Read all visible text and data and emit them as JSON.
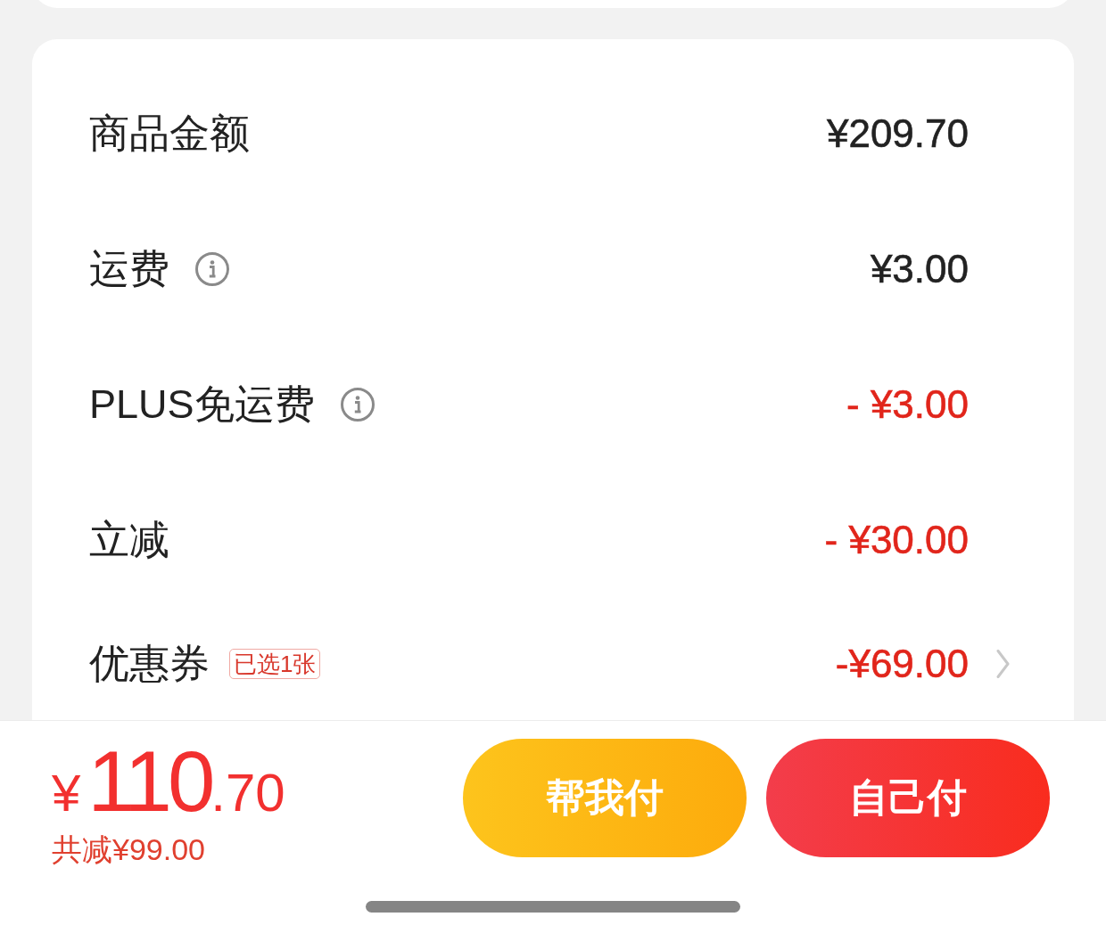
{
  "summary": {
    "rows": [
      {
        "label": "商品金额",
        "value": "¥209.70",
        "kind": "charge",
        "info": false,
        "arrow": false
      },
      {
        "label": "运费",
        "value": "¥3.00",
        "kind": "charge",
        "info": true,
        "arrow": false
      },
      {
        "label": "PLUS免运费",
        "value": "- ¥3.00",
        "kind": "discount",
        "info": true,
        "arrow": false
      },
      {
        "label": "立减",
        "value": "- ¥30.00",
        "kind": "discount",
        "info": false,
        "arrow": false
      },
      {
        "label": "优惠券",
        "tag": "已选1张",
        "value": "-¥69.00",
        "kind": "discount",
        "info": false,
        "arrow": true
      }
    ]
  },
  "checkout": {
    "total": {
      "symbol": "¥",
      "whole": "110",
      "fraction": ".70"
    },
    "savings": "共减¥99.00",
    "buttons": [
      {
        "label": "帮我付",
        "kind": "secondary"
      },
      {
        "label": "自己付",
        "kind": "primary"
      }
    ]
  }
}
